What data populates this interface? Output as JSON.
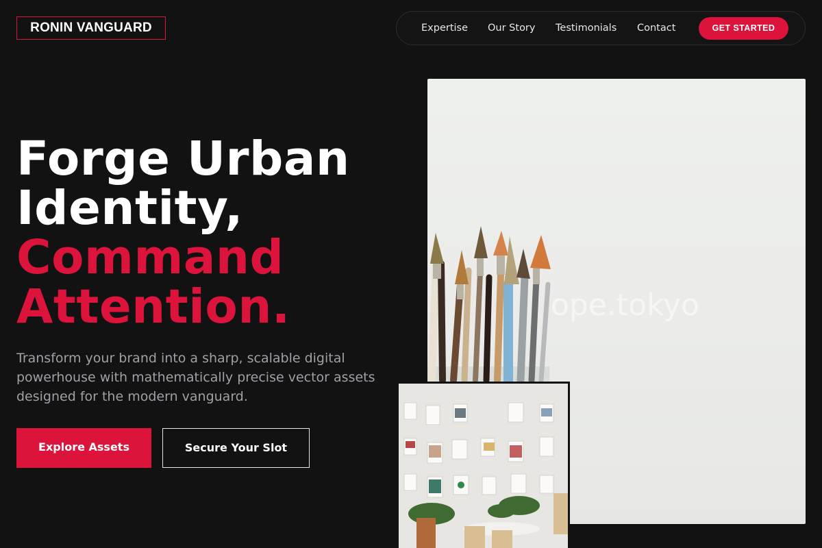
{
  "brand": {
    "name": "RONIN VANGUARD",
    "accent_color": "#dc143c",
    "background_color": "#121213"
  },
  "nav": {
    "links": [
      "Expertise",
      "Our Story",
      "Testimonials",
      "Contact"
    ],
    "cta_label": "GET STARTED"
  },
  "hero": {
    "title_line1": "Forge Urban",
    "title_line2": "Identity,",
    "title_accent_line1": "Command",
    "title_accent_line2": "Attention.",
    "subtitle": "Transform your brand into a sharp, scalable digital powerhouse with mathematically precise vector assets designed for the modern vanguard.",
    "primary_button": "Explore Assets",
    "secondary_button": "Secure Your Slot"
  },
  "images": {
    "main_watermark": "ope.tokyo"
  }
}
